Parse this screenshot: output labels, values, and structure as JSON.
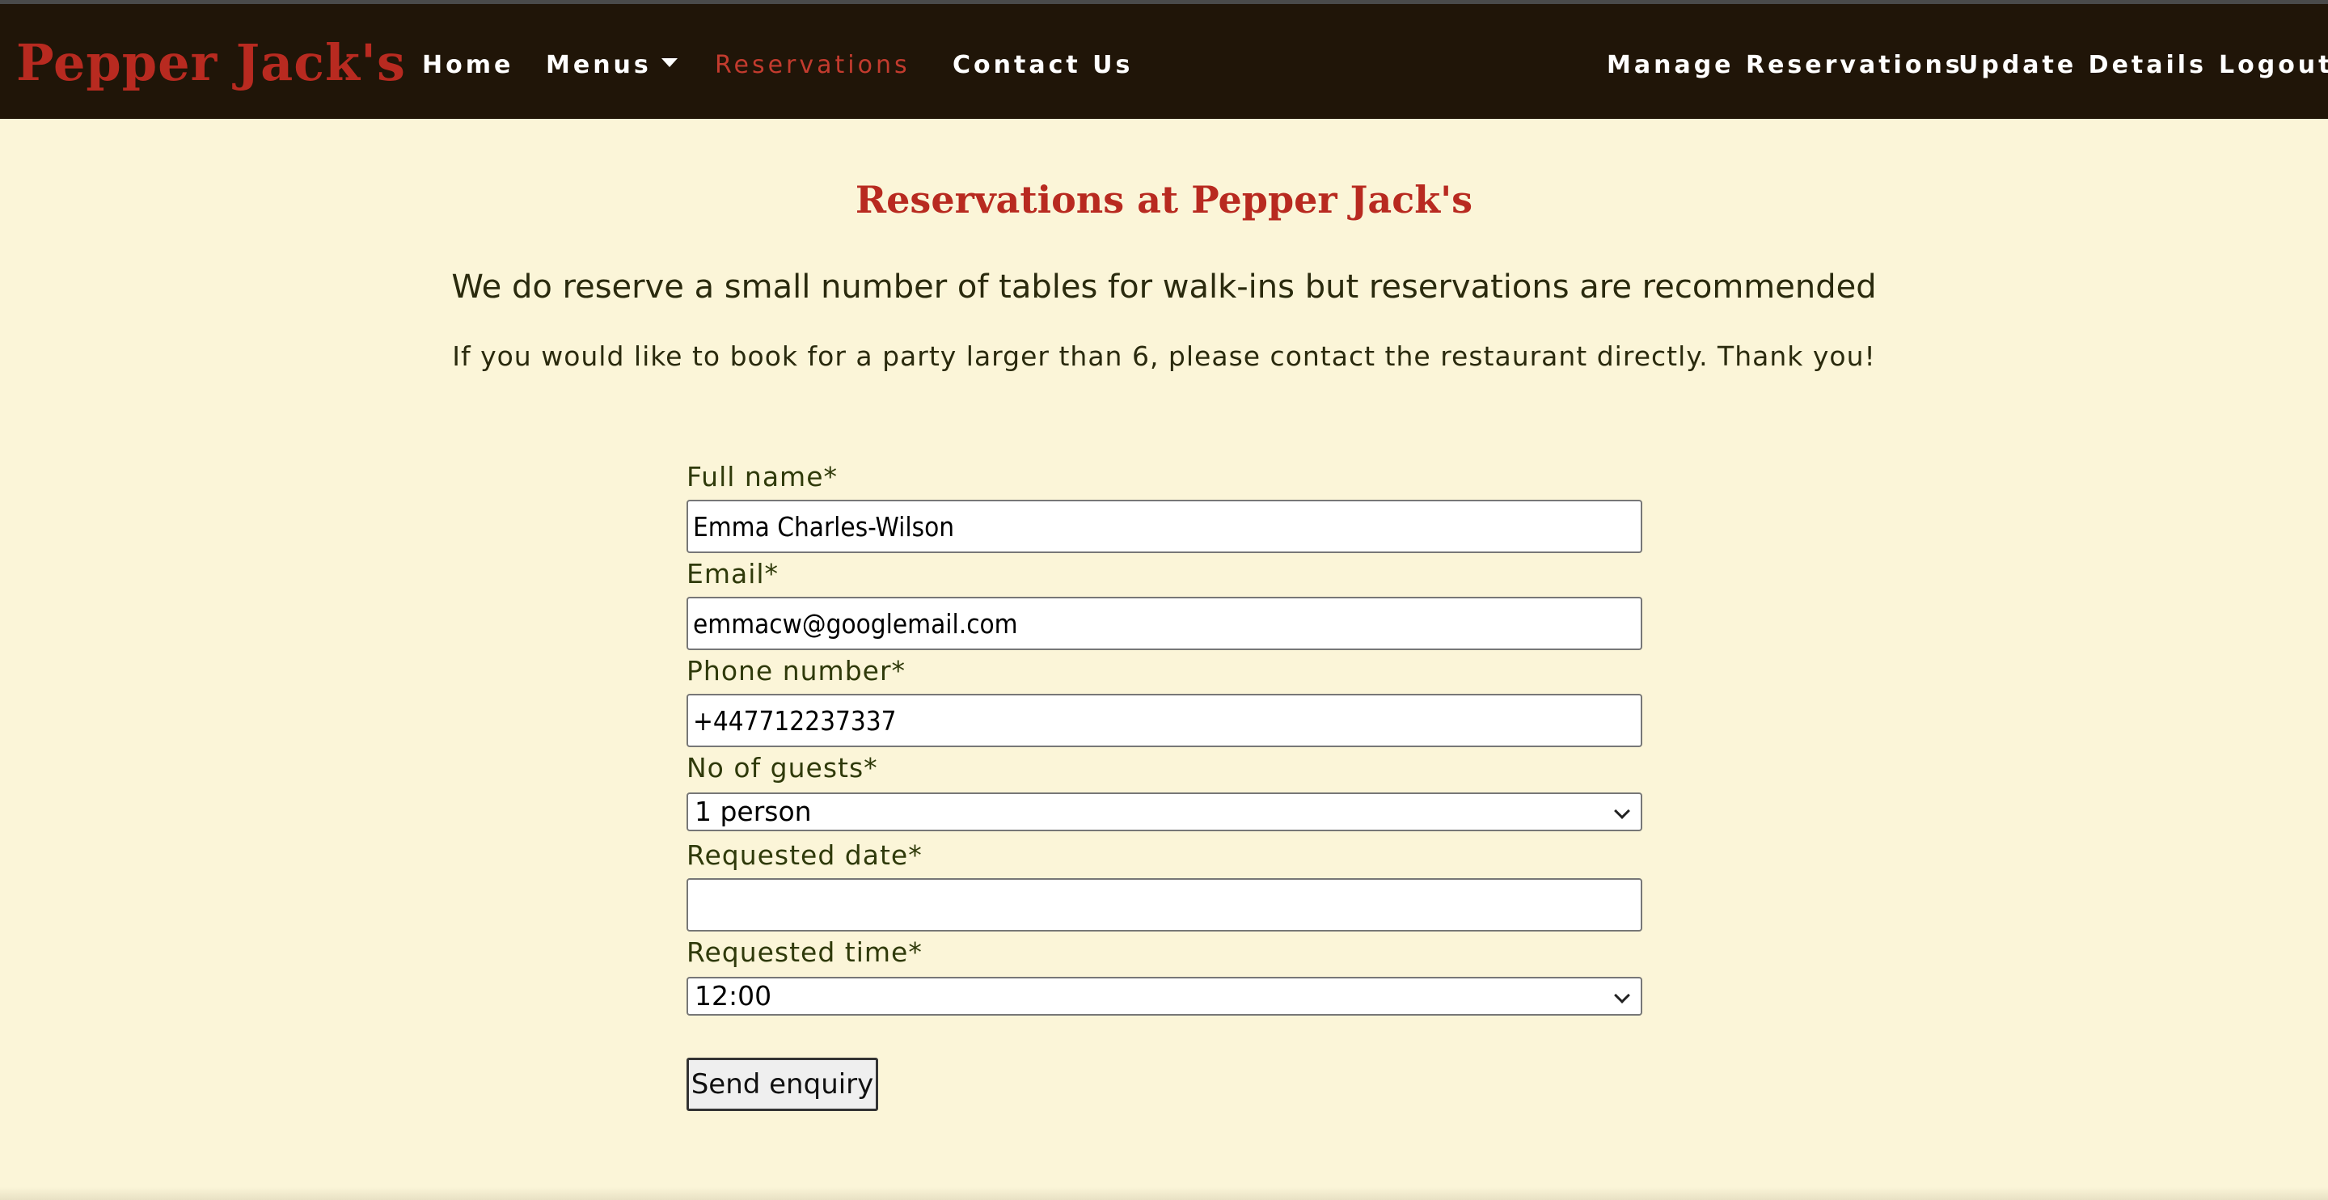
{
  "nav": {
    "brand": "Pepper Jack's",
    "links": [
      "Home",
      "Menus",
      "Reservations",
      "Contact Us"
    ],
    "right_links": [
      "Manage Reservations",
      "Update Details",
      "Logout"
    ],
    "active": "Reservations",
    "colors": {
      "bar": "#201508",
      "brand": "#b82a20",
      "active": "#c33b2e"
    }
  },
  "page": {
    "title": "Reservations at Pepper Jack's",
    "subtitle": "We do reserve a small number of tables for walk-ins but reservations are recommended",
    "note": "If you would like to book for a party larger than 6, please contact the restaurant directly. Thank you!"
  },
  "form": {
    "full_name": {
      "label": "Full name*",
      "value": "Emma Charles-Wilson"
    },
    "email": {
      "label": "Email*",
      "value": "emmacw@googlemail.com"
    },
    "phone": {
      "label": "Phone number*",
      "value": "+447712237337"
    },
    "guests": {
      "label": "No of guests*",
      "selected": "1 person"
    },
    "date": {
      "label": "Requested date*",
      "value": ""
    },
    "time": {
      "label": "Requested time*",
      "selected": "12:00"
    },
    "submit_label": "Send enquiry"
  }
}
